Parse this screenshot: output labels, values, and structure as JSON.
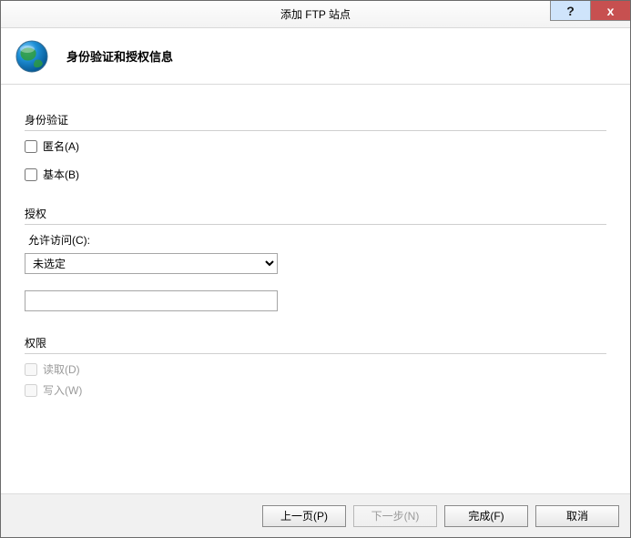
{
  "titlebar": {
    "title": "添加 FTP 站点",
    "help": "?",
    "close": "x"
  },
  "header": {
    "heading": "身份验证和授权信息"
  },
  "auth_section": {
    "label": "身份验证",
    "anonymous": "匿名(A)",
    "basic": "基本(B)"
  },
  "authorization_section": {
    "label": "授权",
    "allow_access_label": "允许访问(C):",
    "select_value": "未选定",
    "textbox_value": ""
  },
  "permissions_section": {
    "label": "权限",
    "read": "读取(D)",
    "write": "写入(W)"
  },
  "footer": {
    "previous": "上一页(P)",
    "next": "下一步(N)",
    "finish": "完成(F)",
    "cancel": "取消"
  }
}
